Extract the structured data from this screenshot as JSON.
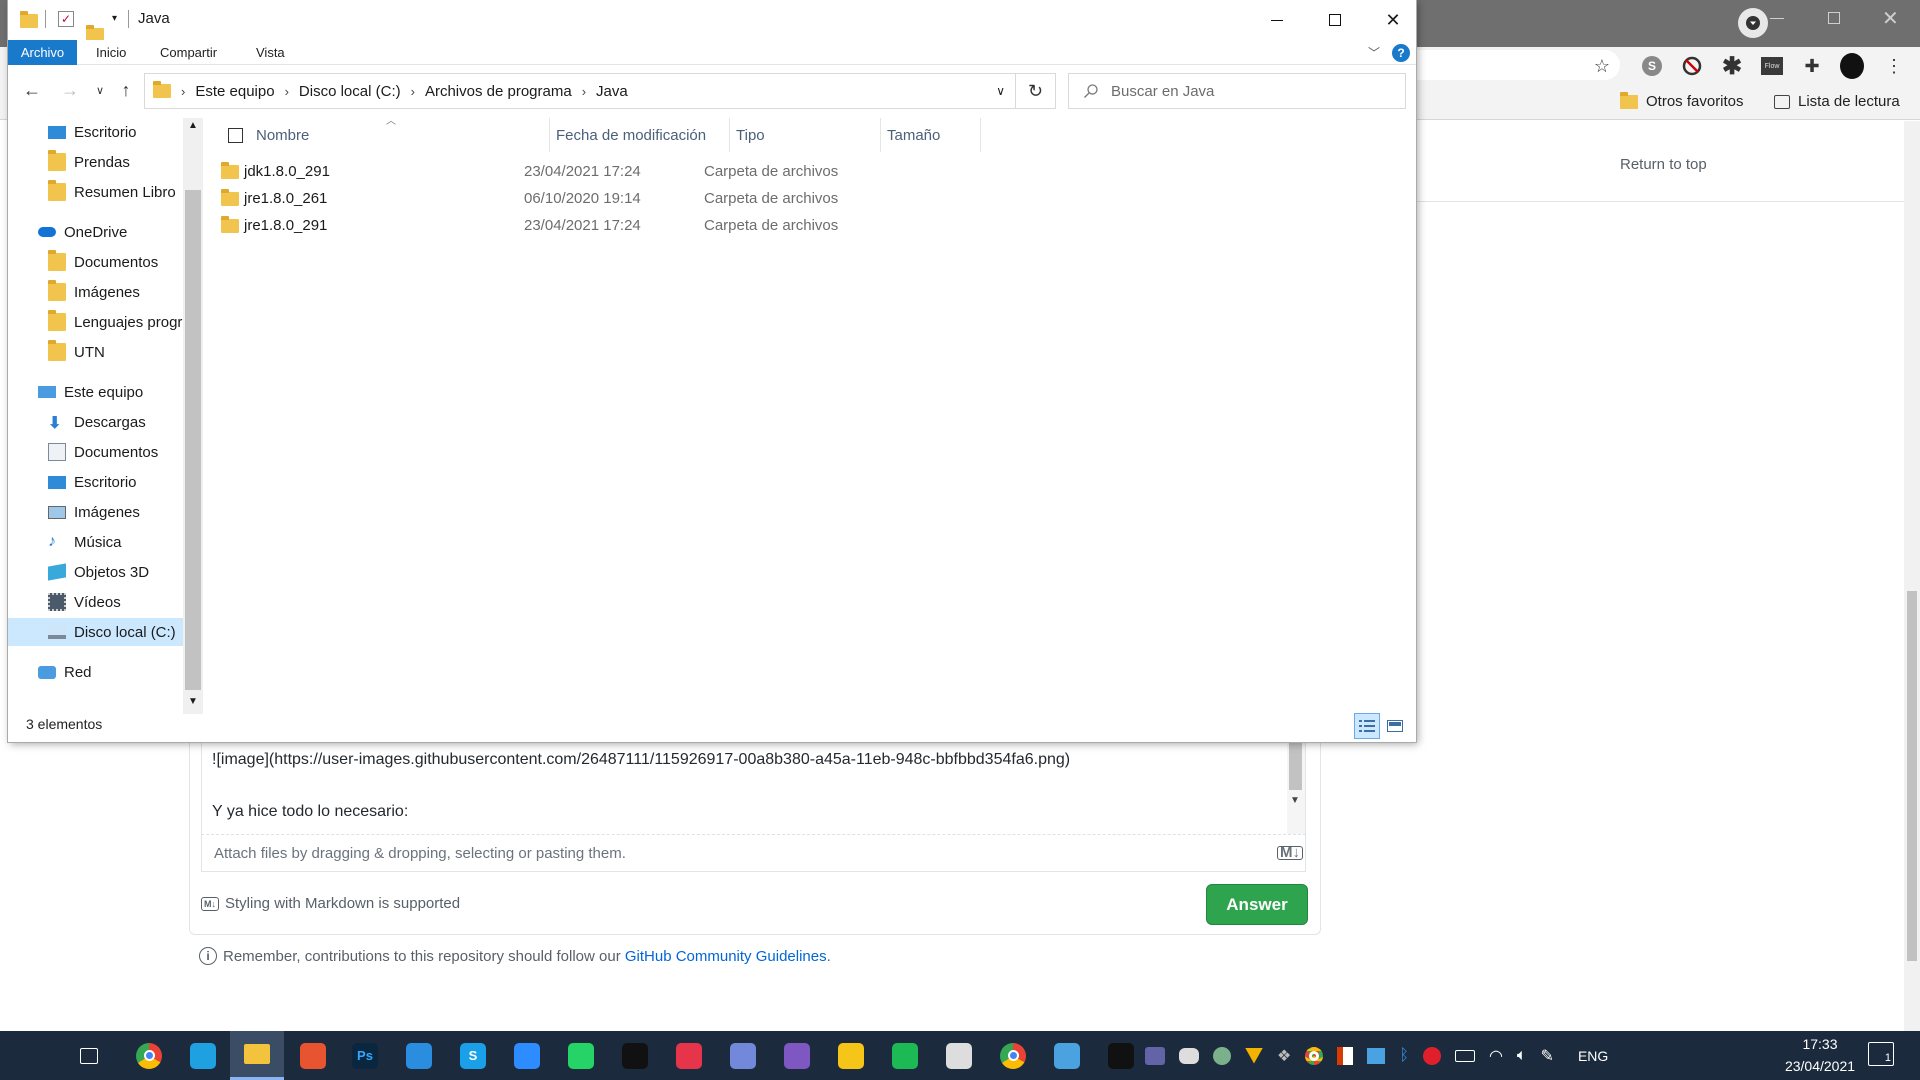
{
  "browser": {
    "bookmarks": [
      {
        "label": "Otros favoritos",
        "icon": "folder-icon"
      },
      {
        "label": "Lista de lectura",
        "icon": "reading-list-icon"
      }
    ],
    "toolbar_icons": [
      "star-icon",
      "s-extension-icon",
      "block-extension-icon",
      "asterisk-extension-icon",
      "flow-extension-icon",
      "puzzle-icon",
      "profile-avatar-icon",
      "kebab-menu-icon"
    ],
    "flow_label": "Flow"
  },
  "github": {
    "return_to_top": "Return to top",
    "editor_line1": "![image](https://user-images.githubusercontent.com/26487111/115926917-00a8b380-a45a-11eb-948c-bbfbbd354fa6.png)",
    "editor_line2": "Y ya hice todo lo necesario:",
    "attach_hint": "Attach files by dragging & dropping, selecting or pasting them.",
    "markdown_hint": "Styling with Markdown is supported",
    "md_badge": "M↓",
    "answer_label": "Answer",
    "guidelines_prefix": "Remember, contributions to this repository should follow our ",
    "guidelines_link": "GitHub Community Guidelines",
    "guidelines_suffix": "."
  },
  "explorer": {
    "title": "Java",
    "ribbon_tabs": [
      "Archivo",
      "Inicio",
      "Compartir",
      "Vista"
    ],
    "help": "?",
    "breadcrumb": [
      "Este equipo",
      "Disco local (C:)",
      "Archivos de programa",
      "Java"
    ],
    "search_placeholder": "Buscar en Java",
    "nav": [
      {
        "label": "Escritorio",
        "icon": "desktop-icon",
        "indent": 1
      },
      {
        "label": "Prendas",
        "icon": "folder-icon",
        "indent": 1
      },
      {
        "label": "Resumen Libro",
        "icon": "folder-icon",
        "indent": 1
      },
      {
        "label": "OneDrive",
        "icon": "onedrive-icon",
        "indent": 0
      },
      {
        "label": "Documentos",
        "icon": "folder-icon",
        "indent": 1
      },
      {
        "label": "Imágenes",
        "icon": "folder-icon",
        "indent": 1
      },
      {
        "label": "Lenguajes progra",
        "icon": "folder-icon",
        "indent": 1
      },
      {
        "label": "UTN",
        "icon": "folder-icon",
        "indent": 1
      },
      {
        "label": "Este equipo",
        "icon": "computer-icon",
        "indent": 0
      },
      {
        "label": "Descargas",
        "icon": "download-icon",
        "indent": 1
      },
      {
        "label": "Documentos",
        "icon": "documents-icon",
        "indent": 1
      },
      {
        "label": "Escritorio",
        "icon": "desktop-icon",
        "indent": 1
      },
      {
        "label": "Imágenes",
        "icon": "pictures-icon",
        "indent": 1
      },
      {
        "label": "Música",
        "icon": "music-icon",
        "indent": 1
      },
      {
        "label": "Objetos 3D",
        "icon": "3d-objects-icon",
        "indent": 1
      },
      {
        "label": "Vídeos",
        "icon": "videos-icon",
        "indent": 1
      },
      {
        "label": "Disco local (C:)",
        "icon": "drive-icon",
        "indent": 1,
        "selected": true
      },
      {
        "label": "Red",
        "icon": "network-icon",
        "indent": 0
      }
    ],
    "columns": [
      "Nombre",
      "Fecha de modificación",
      "Tipo",
      "Tamaño"
    ],
    "files": [
      {
        "name": "jdk1.8.0_291",
        "date": "23/04/2021 17:24",
        "type": "Carpeta de archivos",
        "size": ""
      },
      {
        "name": "jre1.8.0_261",
        "date": "06/10/2020 19:14",
        "type": "Carpeta de archivos",
        "size": ""
      },
      {
        "name": "jre1.8.0_291",
        "date": "23/04/2021 17:24",
        "type": "Carpeta de archivos",
        "size": ""
      }
    ],
    "status": "3 elementos"
  },
  "taskbar": {
    "apps": [
      {
        "name": "start-button",
        "icon": "windows-icon",
        "color": "#ffffff"
      },
      {
        "name": "task-view-button",
        "icon": "task-view-icon",
        "color": "#ffffff"
      },
      {
        "name": "chrome-app",
        "icon": "chrome-icon",
        "color": "#e94235"
      },
      {
        "name": "edge-app",
        "icon": "edge-icon",
        "color": "#1fa0e0"
      },
      {
        "name": "file-explorer-app",
        "icon": "folder-icon",
        "color": "#f3c33d"
      },
      {
        "name": "origin-app",
        "icon": "swirl-icon",
        "color": "#e8542f"
      },
      {
        "name": "photoshop-app",
        "icon": "photoshop-icon",
        "color": "#0b2740",
        "glyph": "Ps"
      },
      {
        "name": "vscode-app",
        "icon": "vscode-icon",
        "color": "#2a8de0"
      },
      {
        "name": "skype-app",
        "icon": "skype-icon",
        "color": "#1aa0e8",
        "glyph": "S"
      },
      {
        "name": "zoom-app",
        "icon": "zoom-icon",
        "color": "#2d8cff"
      },
      {
        "name": "whatsapp-app",
        "icon": "whatsapp-icon",
        "color": "#25d366"
      },
      {
        "name": "acrobat-app",
        "icon": "acrobat-icon",
        "color": "#111111"
      },
      {
        "name": "streamlabs-app",
        "icon": "streamlabs-icon",
        "color": "#e6354b"
      },
      {
        "name": "discord-app",
        "icon": "discord-icon",
        "color": "#7289da"
      },
      {
        "name": "visual-studio-app",
        "icon": "vs-icon",
        "color": "#7e57c2"
      },
      {
        "name": "notes-app",
        "icon": "note-icon",
        "color": "#f5c518"
      },
      {
        "name": "spotify-app",
        "icon": "spotify-icon",
        "color": "#1db954"
      },
      {
        "name": "virtualbox-app",
        "icon": "cube-icon",
        "color": "#dddddd"
      },
      {
        "name": "chrome-profile-app",
        "icon": "chrome-icon",
        "color": "#e94235"
      },
      {
        "name": "screen-app",
        "icon": "screen-icon",
        "color": "#4aa3e0"
      },
      {
        "name": "terminal-app",
        "icon": "terminal-icon",
        "color": "#111111"
      }
    ],
    "tray_icons": [
      "teams-icon",
      "discord-icon",
      "vpn-icon",
      "norton-icon",
      "dropbox-icon",
      "chrome-icon",
      "office-icon",
      "store-icon",
      "bluetooth-icon",
      "beats-icon",
      "battery-icon",
      "wifi-icon",
      "volume-icon",
      "pen-icon"
    ],
    "lang": "ENG",
    "time": "17:33",
    "date": "23/04/2021",
    "notifications": "1"
  }
}
